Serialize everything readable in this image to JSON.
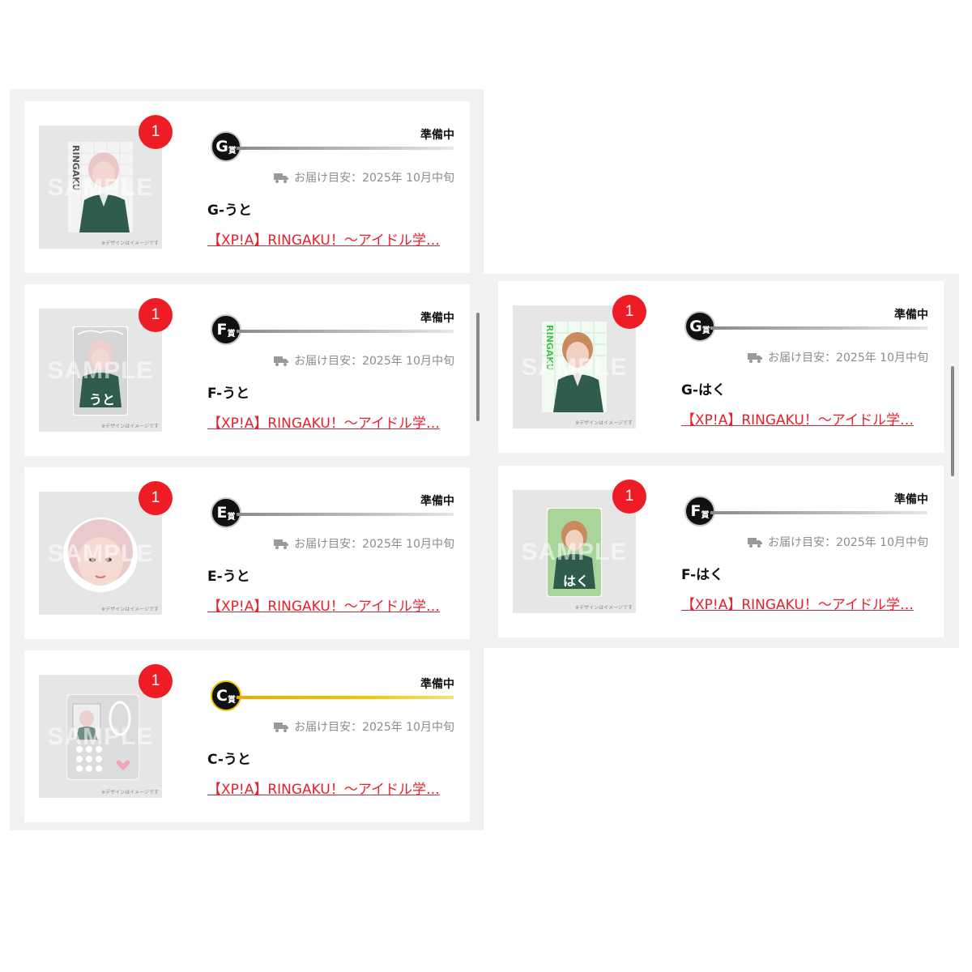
{
  "cards": [
    {
      "prize_letter": "G",
      "prize_kanji": "賞",
      "status": "準備中",
      "delivery": "お届け目安：2025年 10月中旬",
      "name": "G-うと",
      "link": "【XP!A】RINGAKU！～アイドル学…",
      "quantity": "1",
      "sample": "SAMPLE",
      "note": "※デザインはイメージです",
      "image": "photo-card"
    },
    {
      "prize_letter": "F",
      "prize_kanji": "賞",
      "status": "準備中",
      "delivery": "お届け目安：2025年 10月中旬",
      "name": "F-うと",
      "link": "【XP!A】RINGAKU！～アイドル学…",
      "quantity": "1",
      "sample": "SAMPLE",
      "note": "※デザインはイメージです",
      "image": "acrylic-card"
    },
    {
      "prize_letter": "E",
      "prize_kanji": "賞",
      "status": "準備中",
      "delivery": "お届け目安：2025年 10月中旬",
      "name": "E-うと",
      "link": "【XP!A】RINGAKU！～アイドル学…",
      "quantity": "1",
      "sample": "SAMPLE",
      "note": "※デザインはイメージです",
      "image": "face-sticker"
    },
    {
      "prize_letter": "C",
      "prize_kanji": "賞",
      "status": "準備中",
      "delivery": "お届け目安：2025年 10月中旬",
      "name": "C-うと",
      "link": "【XP!A】RINGAKU！～アイドル学…",
      "quantity": "1",
      "sample": "SAMPLE",
      "note": "※デザインはイメージです",
      "image": "phone-stand"
    },
    {
      "prize_letter": "G",
      "prize_kanji": "賞",
      "status": "準備中",
      "delivery": "お届け目安：2025年 10月中旬",
      "name": "G-はく",
      "link": "【XP!A】RINGAKU！～アイドル学…",
      "quantity": "1",
      "sample": "SAMPLE",
      "note": "※デザインはイメージです",
      "image": "photo-card"
    },
    {
      "prize_letter": "F",
      "prize_kanji": "賞",
      "status": "準備中",
      "delivery": "お届け目安：2025年 10月中旬",
      "name": "F-はく",
      "link": "【XP!A】RINGAKU！～アイドル学…",
      "quantity": "1",
      "sample": "SAMPLE",
      "note": "※デザインはイメージです",
      "image": "acrylic-card"
    }
  ],
  "colors": {
    "accent": "#ee1c25",
    "link": "#e8202a",
    "panel": "#f2f2f2",
    "gold": "#f0c400"
  }
}
